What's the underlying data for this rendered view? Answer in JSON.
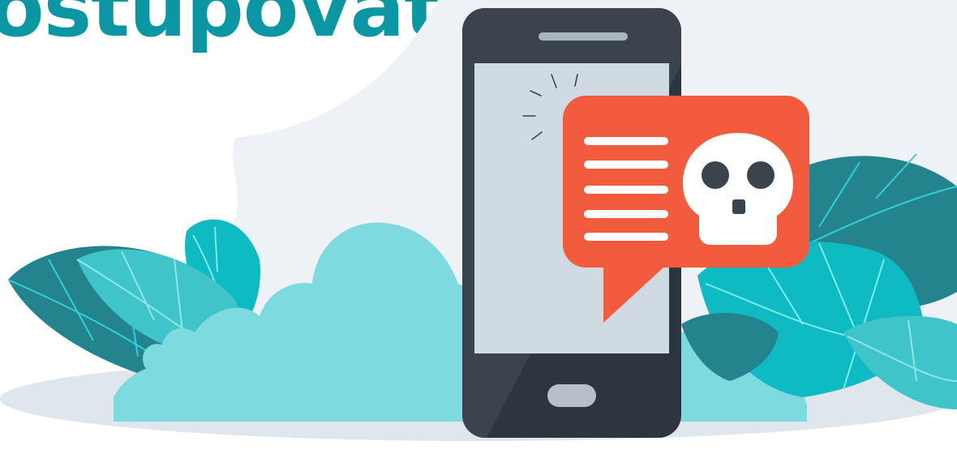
{
  "headline": {
    "text": "ostupovat?",
    "color": "#0a96a3"
  },
  "illustration": {
    "icons": [
      "smartphone-icon",
      "warning-message-bubble-icon",
      "skull-icon",
      "leaf-icon",
      "cloud-bush-icon"
    ],
    "colors": {
      "background_shape": "#eef2f6",
      "ground_shadow": "#dfe6ec",
      "phone_body": "#3b434c",
      "phone_shadow": "#2d3540",
      "screen": "#cfdae3",
      "bubble": "#f25c3c",
      "skull": "#ffffff",
      "skull_features": "#3b434c",
      "leaf_dark": "#23848e",
      "leaf_mid": "#3fc4c9",
      "leaf_bright": "#0fbbc3",
      "cloud": "#7ddbe0"
    }
  }
}
